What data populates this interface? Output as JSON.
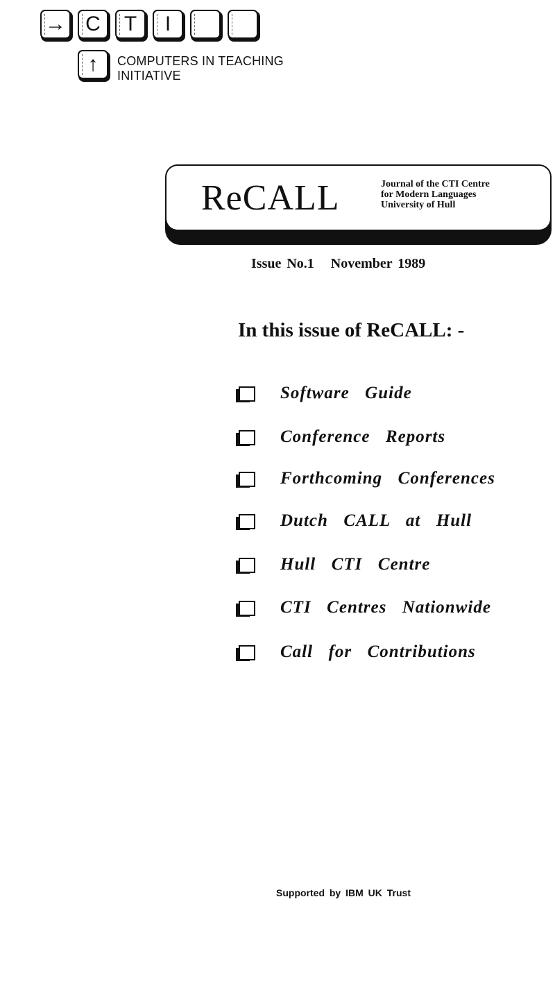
{
  "logo": {
    "keys": [
      {
        "glyph": "→",
        "icon": "right-arrow-icon"
      },
      {
        "glyph": "C",
        "icon": ""
      },
      {
        "glyph": "T",
        "icon": ""
      },
      {
        "glyph": "I",
        "icon": ""
      },
      {
        "glyph": "",
        "icon": ""
      },
      {
        "glyph": "",
        "icon": ""
      }
    ],
    "up_key": {
      "glyph": "↑",
      "icon": "up-arrow-icon"
    },
    "label_line1": "COMPUTERS IN TEACHING",
    "label_line2": "INITIATIVE"
  },
  "banner": {
    "title": "ReCALL",
    "subtitle_line1": "Journal of the CTI Centre",
    "subtitle_line2": "for Modern Languages",
    "subtitle_line3": "University of Hull"
  },
  "issue": {
    "text": "Issue No.1   November 1989"
  },
  "contents": {
    "heading": "In this issue of ReCALL: -",
    "items": [
      {
        "label": "Software  Guide"
      },
      {
        "label": "Conference  Reports"
      },
      {
        "label": "Forthcoming  Conferences"
      },
      {
        "label": "Dutch  CALL  at  Hull"
      },
      {
        "label": "Hull  CTI  Centre"
      },
      {
        "label": "CTI  Centres  Nationwide"
      },
      {
        "label": "Call  for  Contributions"
      }
    ]
  },
  "footer": {
    "support": "Supported by IBM UK Trust"
  }
}
